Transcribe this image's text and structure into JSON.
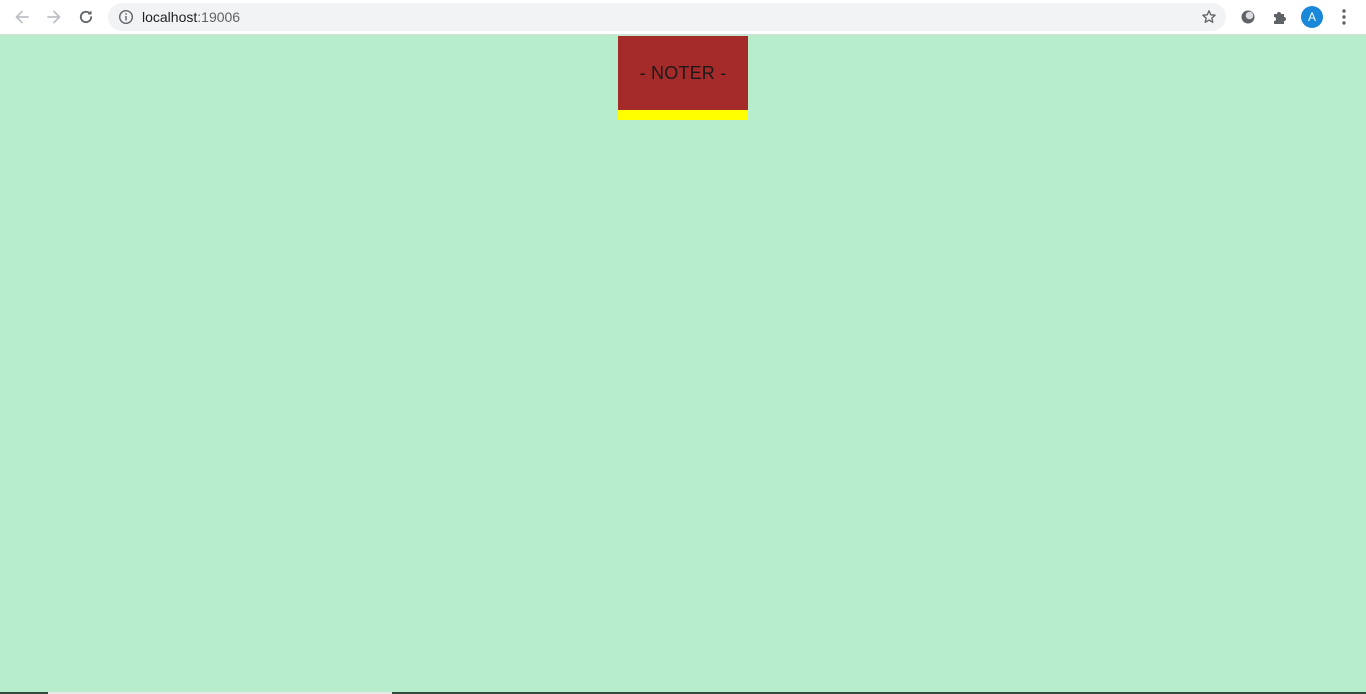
{
  "browser": {
    "url_host": "localhost",
    "url_port": ":19006",
    "avatar_letter": "A",
    "avatar_color": "#1a88d8",
    "icons": {
      "back": "back-arrow-icon",
      "forward": "forward-arrow-icon",
      "reload": "reload-icon",
      "site_info": "info-icon",
      "bookmark": "star-icon",
      "extension_1": "circle-extension-icon",
      "extensions": "puzzle-icon",
      "menu": "kebab-menu-icon"
    }
  },
  "page": {
    "background_color": "#b8edcc",
    "header": {
      "title": "- NOTER -",
      "background_color": "#a52a2a",
      "underline_color": "#ffff00"
    }
  }
}
